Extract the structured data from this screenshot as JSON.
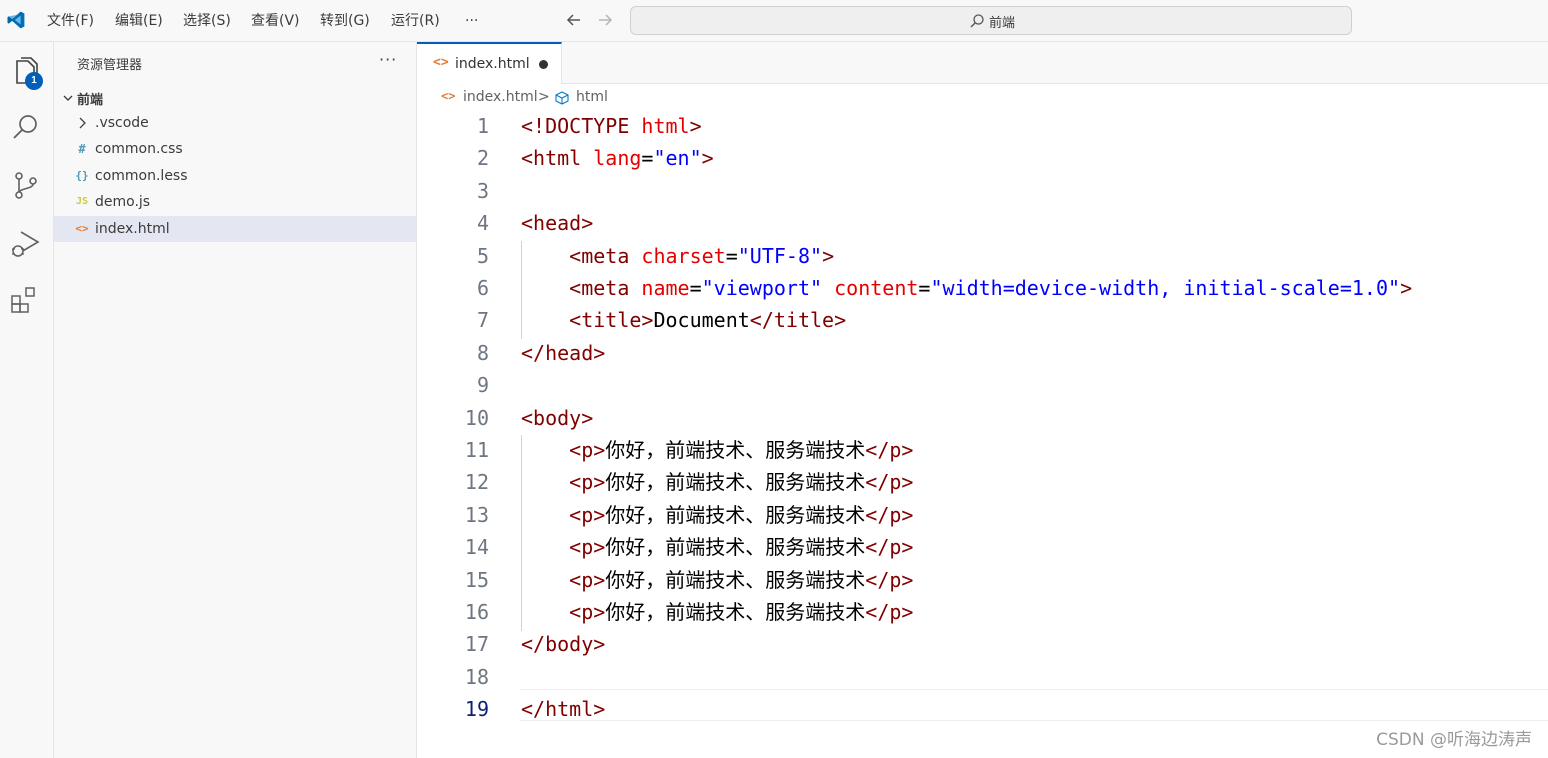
{
  "menu": {
    "items": [
      "文件(F)",
      "编辑(E)",
      "选择(S)",
      "查看(V)",
      "转到(G)",
      "运行(R)"
    ],
    "more": "···"
  },
  "command_center": {
    "text": "前端"
  },
  "activity": {
    "explorer_badge": "1"
  },
  "sidebar": {
    "title": "资源管理器",
    "more": "···",
    "folder": "前端",
    "files": [
      {
        "name": ".vscode",
        "icon": "chevron-right-icon",
        "color": "#424242"
      },
      {
        "name": "common.css",
        "icon": "#",
        "color": "#519aba"
      },
      {
        "name": "common.less",
        "icon": "{}",
        "color": "#519aba"
      },
      {
        "name": "demo.js",
        "icon": "JS",
        "color": "#cbcb41"
      },
      {
        "name": "index.html",
        "icon": "<>",
        "color": "#e37933",
        "selected": true
      }
    ]
  },
  "tab": {
    "name": "index.html",
    "icon": "<>",
    "dirty": true
  },
  "breadcrumb": {
    "file": "index.html",
    "separator": ">",
    "element": "html"
  },
  "code": {
    "current_line": 19,
    "lines": [
      [
        [
          "t",
          "<!DOCTYPE "
        ],
        [
          "a",
          "html"
        ],
        [
          "t",
          ">"
        ]
      ],
      [
        [
          "t",
          "<html "
        ],
        [
          "a",
          "lang"
        ],
        [
          "x",
          "="
        ],
        [
          "v",
          "\"en\""
        ],
        [
          "t",
          ">"
        ]
      ],
      [],
      [
        [
          "t",
          "<head>"
        ]
      ],
      [
        [
          "x",
          "    "
        ],
        [
          "t",
          "<meta "
        ],
        [
          "a",
          "charset"
        ],
        [
          "x",
          "="
        ],
        [
          "v",
          "\"UTF-8\""
        ],
        [
          "t",
          ">"
        ]
      ],
      [
        [
          "x",
          "    "
        ],
        [
          "t",
          "<meta "
        ],
        [
          "a",
          "name"
        ],
        [
          "x",
          "="
        ],
        [
          "v",
          "\"viewport\""
        ],
        [
          "x",
          " "
        ],
        [
          "a",
          "content"
        ],
        [
          "x",
          "="
        ],
        [
          "v",
          "\"width=device-width, initial-scale=1.0\""
        ],
        [
          "t",
          ">"
        ]
      ],
      [
        [
          "x",
          "    "
        ],
        [
          "t",
          "<title>"
        ],
        [
          "x",
          "Document"
        ],
        [
          "t",
          "</title>"
        ]
      ],
      [
        [
          "t",
          "</head>"
        ]
      ],
      [],
      [
        [
          "t",
          "<body>"
        ]
      ],
      [
        [
          "x",
          "    "
        ],
        [
          "t",
          "<p>"
        ],
        [
          "x",
          "你好，前端技术、服务端技术"
        ],
        [
          "t",
          "</p>"
        ]
      ],
      [
        [
          "x",
          "    "
        ],
        [
          "t",
          "<p>"
        ],
        [
          "x",
          "你好，前端技术、服务端技术"
        ],
        [
          "t",
          "</p>"
        ]
      ],
      [
        [
          "x",
          "    "
        ],
        [
          "t",
          "<p>"
        ],
        [
          "x",
          "你好，前端技术、服务端技术"
        ],
        [
          "t",
          "</p>"
        ]
      ],
      [
        [
          "x",
          "    "
        ],
        [
          "t",
          "<p>"
        ],
        [
          "x",
          "你好，前端技术、服务端技术"
        ],
        [
          "t",
          "</p>"
        ]
      ],
      [
        [
          "x",
          "    "
        ],
        [
          "t",
          "<p>"
        ],
        [
          "x",
          "你好，前端技术、服务端技术"
        ],
        [
          "t",
          "</p>"
        ]
      ],
      [
        [
          "x",
          "    "
        ],
        [
          "t",
          "<p>"
        ],
        [
          "x",
          "你好，前端技术、服务端技术"
        ],
        [
          "t",
          "</p>"
        ]
      ],
      [
        [
          "t",
          "</body>"
        ]
      ],
      [],
      [
        [
          "t",
          "</html>"
        ]
      ]
    ]
  },
  "colors": {
    "accent": "#005fb8",
    "tag": "#800000",
    "attribute": "#e50000",
    "value": "#0000ff",
    "html_icon": "#e37933"
  },
  "watermark": "CSDN @听海边涛声"
}
